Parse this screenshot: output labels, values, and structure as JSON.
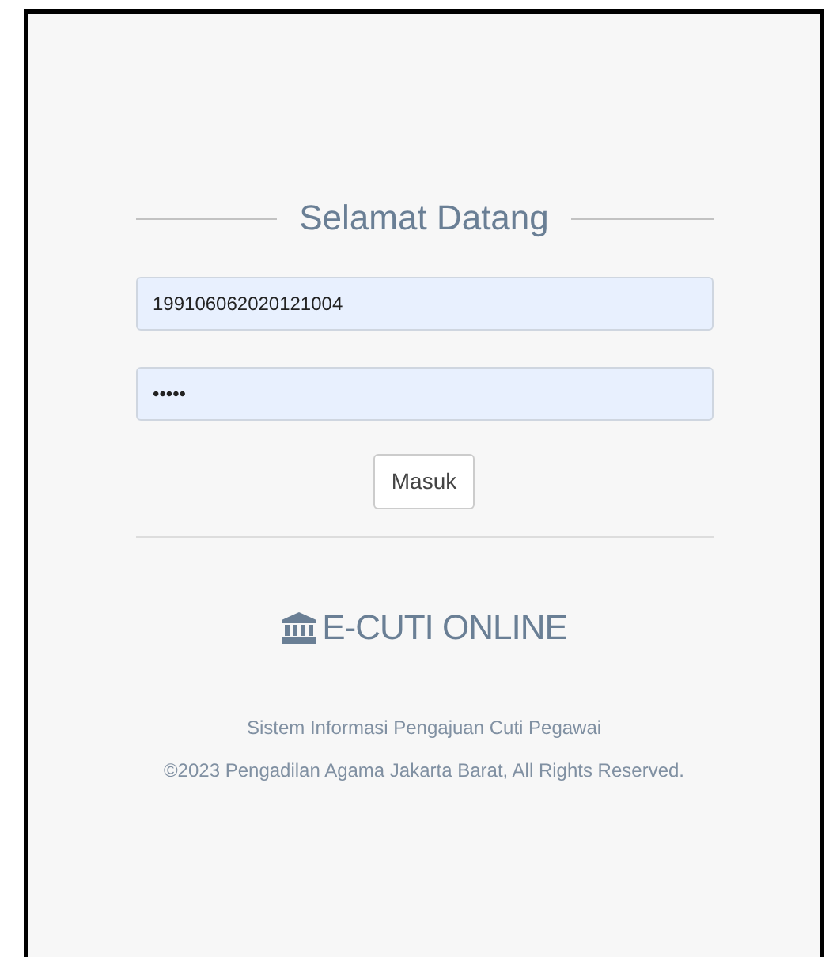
{
  "login": {
    "title": "Selamat Datang",
    "username": {
      "value": "199106062020121004"
    },
    "password": {
      "value": "•••••"
    },
    "submit": "Masuk"
  },
  "brand": {
    "name": "E-CUTI ONLINE",
    "tagline": "Sistem Informasi Pengajuan Cuti Pegawai",
    "copyright": "©2023 Pengadilan Agama Jakarta Barat, All Rights Reserved."
  }
}
